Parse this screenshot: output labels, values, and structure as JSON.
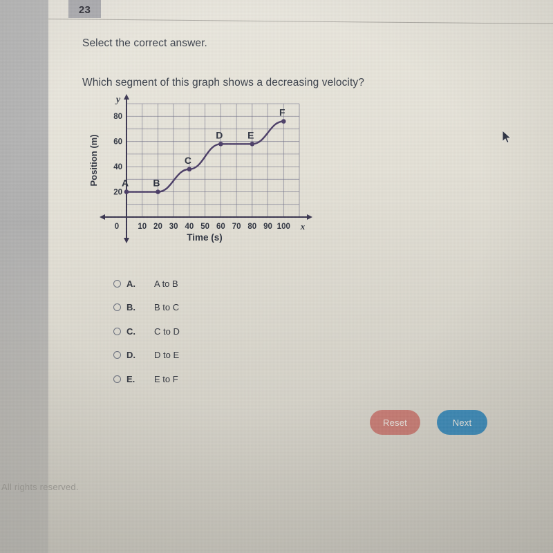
{
  "header": {
    "question_number": "23"
  },
  "prompt": {
    "instruction": "Select the correct answer.",
    "question": "Which segment of this graph shows a decreasing velocity?"
  },
  "chart_data": {
    "type": "line",
    "title": "",
    "xlabel": "Time (s)",
    "ylabel": "Position (m)",
    "x_axis_var": "x",
    "y_axis_var": "y",
    "xlim": [
      0,
      110
    ],
    "ylim": [
      0,
      90
    ],
    "xticks": [
      "10",
      "20",
      "30",
      "40",
      "50",
      "60",
      "70",
      "80",
      "90",
      "100"
    ],
    "xtick_values": [
      10,
      20,
      30,
      40,
      50,
      60,
      70,
      80,
      90,
      100
    ],
    "origin_label": "0",
    "yticks": [
      "20",
      "40",
      "60",
      "80"
    ],
    "ytick_values": [
      20,
      40,
      60,
      80
    ],
    "grid": true,
    "grid_step_x": 10,
    "grid_step_y": 10,
    "line_color": "#4a3c66",
    "points": [
      {
        "label": "A",
        "x": 0,
        "y": 20
      },
      {
        "label": "B",
        "x": 20,
        "y": 20
      },
      {
        "label": "C",
        "x": 40,
        "y": 38
      },
      {
        "label": "D",
        "x": 60,
        "y": 58
      },
      {
        "label": "E",
        "x": 80,
        "y": 58
      },
      {
        "label": "F",
        "x": 100,
        "y": 76
      }
    ]
  },
  "options": [
    {
      "letter": "A.",
      "text": "A to B",
      "selected": false
    },
    {
      "letter": "B.",
      "text": "B to C",
      "selected": false
    },
    {
      "letter": "C.",
      "text": "C to D",
      "selected": false
    },
    {
      "letter": "D.",
      "text": "D to E",
      "selected": false
    },
    {
      "letter": "E.",
      "text": "E to F",
      "selected": false
    }
  ],
  "buttons": {
    "reset_label": "Reset",
    "next_label": "Next",
    "reset_color": "#cf8179",
    "next_color": "#3f8fbe"
  },
  "footer": {
    "copyright": "All rights reserved."
  }
}
